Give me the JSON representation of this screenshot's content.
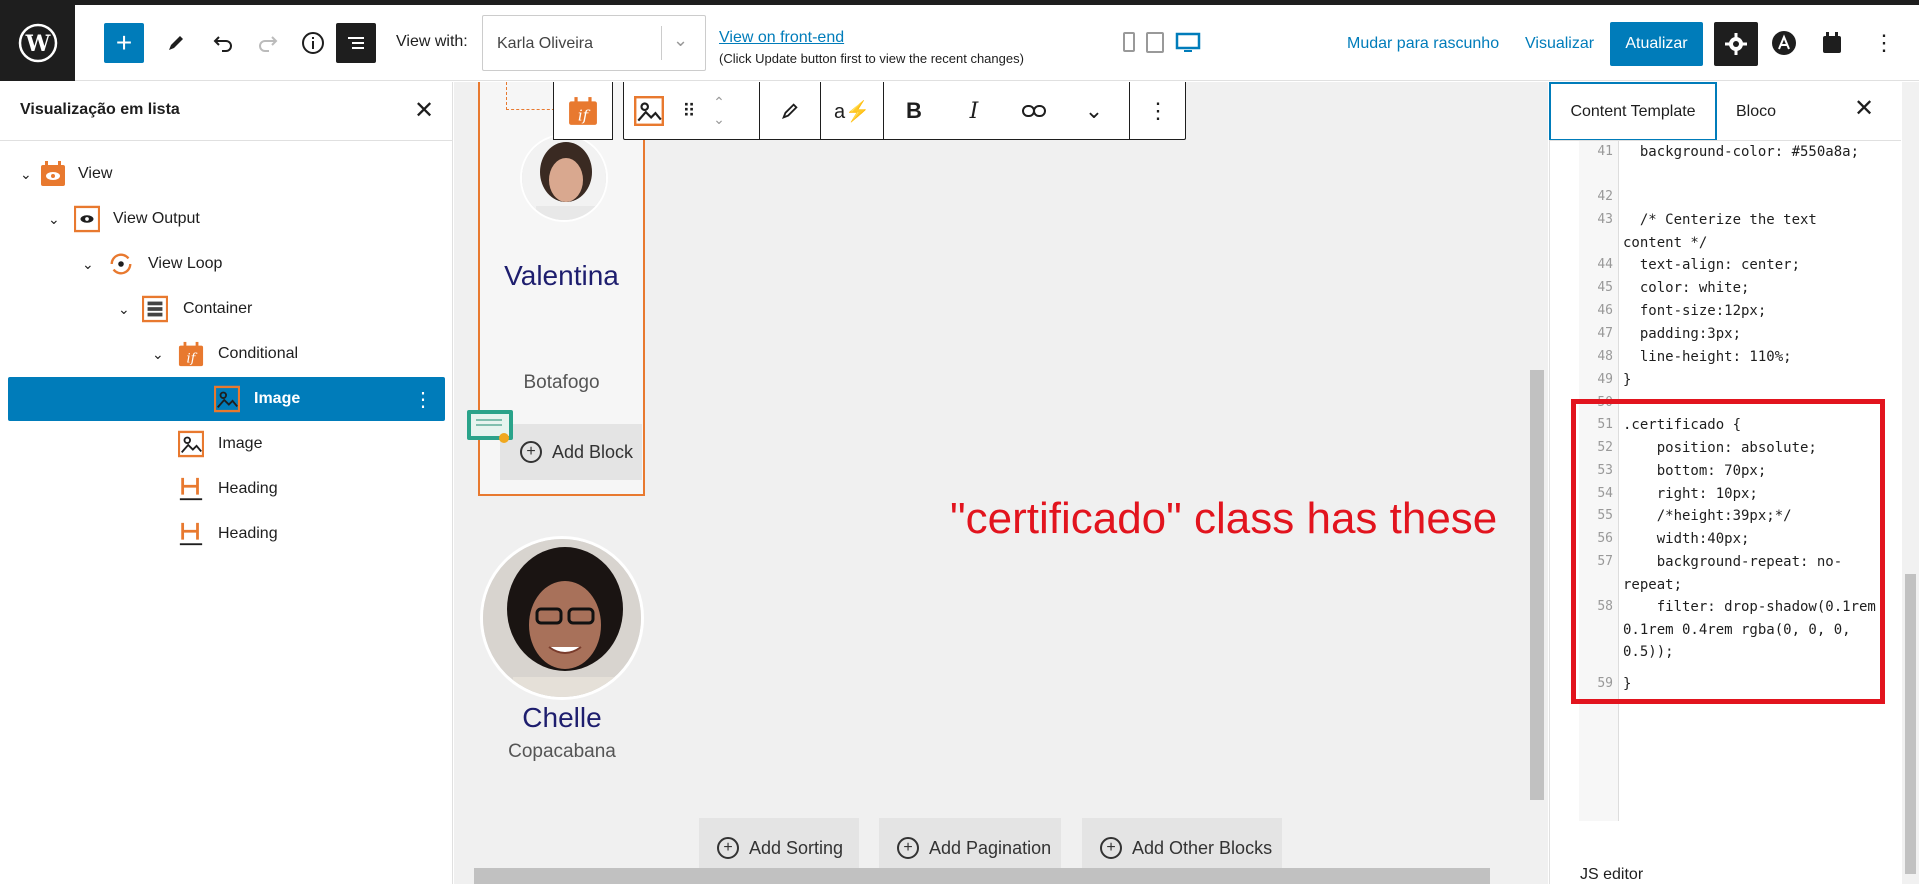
{
  "toolbar": {
    "view_with_label": "View with:",
    "view_with_value": "Karla Oliveira",
    "front_end_link": "View on front-end",
    "front_end_note": "(Click Update button first to view the recent changes)",
    "draft_link": "Mudar para rascunho",
    "preview_link": "Visualizar",
    "update_button": "Atualizar",
    "icons": [
      "wordpress-logo",
      "plus-icon",
      "pencil-icon",
      "undo-icon",
      "redo-icon",
      "info-icon",
      "list-view-icon",
      "mobile-icon",
      "tablet-icon",
      "desktop-icon",
      "gear-icon",
      "astra-icon",
      "toolset-icon",
      "more-icon"
    ]
  },
  "list_view": {
    "title": "Visualização em lista",
    "items": [
      {
        "label": "View"
      },
      {
        "label": "View Output"
      },
      {
        "label": "View Loop"
      },
      {
        "label": "Container"
      },
      {
        "label": "Conditional"
      },
      {
        "label": "Image"
      },
      {
        "label": "Image"
      },
      {
        "label": "Heading"
      },
      {
        "label": "Heading"
      }
    ]
  },
  "canvas": {
    "cards": [
      {
        "name": "Valentina",
        "location": "Botafogo"
      },
      {
        "name": "Chelle",
        "location": "Copacabana"
      }
    ],
    "add_block_label": "Add Block",
    "annotation": "\"certificado\" class has these",
    "bottom_buttons": [
      "Add Sorting",
      "Add Pagination",
      "Add Other Blocks"
    ],
    "block_toolbar_icons": [
      "conditional-icon",
      "image-icon",
      "drag-icon",
      "move-up-down-icon",
      "pencil-icon",
      "dynamic-text-icon",
      "bold-icon",
      "italic-icon",
      "link-icon",
      "chevron-down-icon",
      "more-icon"
    ]
  },
  "right_panel": {
    "tab_content_template": "Content Template",
    "tab_block": "Bloco",
    "js_editor_label": "JS editor",
    "code_lines": [
      {
        "num": "41",
        "text": "  background-color: #550a8a;"
      },
      {
        "num": "42",
        "text": ""
      },
      {
        "num": "43",
        "text": "  /* Centerize the text content */"
      },
      {
        "num": "44",
        "text": "  text-align: center;"
      },
      {
        "num": "45",
        "text": "  color: white;"
      },
      {
        "num": "46",
        "text": "  font-size:12px;"
      },
      {
        "num": "47",
        "text": "  padding:3px;"
      },
      {
        "num": "48",
        "text": "  line-height: 110%;"
      },
      {
        "num": "49",
        "text": "}"
      },
      {
        "num": "50",
        "text": ""
      },
      {
        "num": "51",
        "text": ".certificado {"
      },
      {
        "num": "52",
        "text": "    position: absolute;"
      },
      {
        "num": "53",
        "text": "    bottom: 70px;"
      },
      {
        "num": "54",
        "text": "    right: 10px;"
      },
      {
        "num": "55",
        "text": "    /*height:39px;*/"
      },
      {
        "num": "56",
        "text": "    width:40px;"
      },
      {
        "num": "57",
        "text": "    background-repeat: no-repeat;"
      },
      {
        "num": "58",
        "text": "    filter: drop-shadow(0.1rem 0.1rem 0.4rem rgba(0, 0, 0, 0.5));"
      },
      {
        "num": "59",
        "text": "}"
      }
    ]
  },
  "colors": {
    "accent": "#007cba",
    "toolset_orange": "#e8792f",
    "annotation_red": "#e2141e"
  }
}
